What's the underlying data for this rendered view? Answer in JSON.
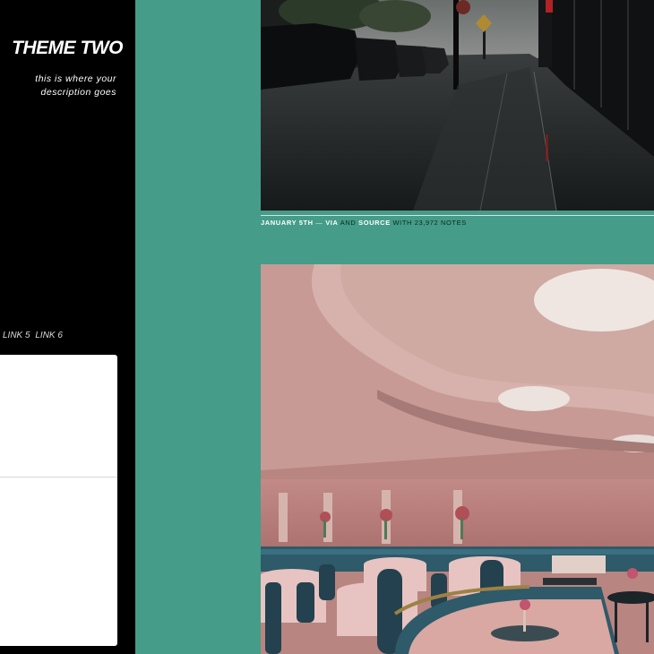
{
  "blog": {
    "title": "THEME TWO",
    "description_line1": "this is where your",
    "description_line2": "description goes"
  },
  "nav": {
    "links": [
      "LINK 5",
      "LINK 6"
    ]
  },
  "post1": {
    "date": "JANUARY 5TH",
    "dash": "—",
    "via": "VIA",
    "and": "AND",
    "source": "SOURCE",
    "with": "WITH",
    "notes": "23,972 NOTES"
  },
  "colors": {
    "background": "#459c88",
    "sidebar": "#000000",
    "widget": "#ffffff"
  }
}
